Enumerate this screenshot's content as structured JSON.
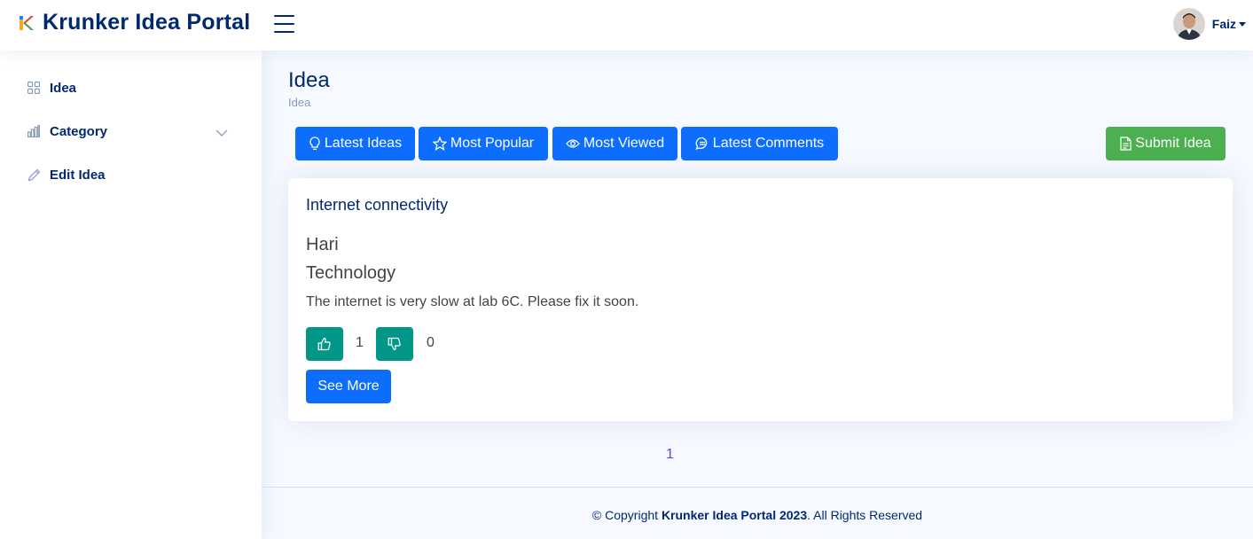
{
  "header": {
    "app_title": "Krunker Idea Portal",
    "user_name": "Faiz"
  },
  "sidebar": {
    "items": [
      {
        "label": "Idea",
        "icon": "grid-icon"
      },
      {
        "label": "Category",
        "icon": "bar-chart-icon"
      },
      {
        "label": "Edit Idea",
        "icon": "pencil-icon"
      }
    ]
  },
  "main": {
    "page_title": "Idea",
    "breadcrumb": "Idea",
    "filters": [
      {
        "label": "Latest Ideas",
        "icon": "lightbulb-icon"
      },
      {
        "label": "Most Popular",
        "icon": "star-icon"
      },
      {
        "label": "Most Viewed",
        "icon": "eye-icon"
      },
      {
        "label": "Latest Comments",
        "icon": "chat-icon"
      }
    ],
    "submit_label": "Submit Idea",
    "idea": {
      "title": "Internet connectivity",
      "author": "Hari",
      "category": "Technology",
      "description": "The internet is very slow at lab 6C. Please fix it soon.",
      "likes": "1",
      "dislikes": "0",
      "see_more_label": "See More"
    },
    "pagination": [
      "1"
    ]
  },
  "footer": {
    "prefix": "© Copyright ",
    "brand": "Krunker Idea Portal 2023",
    "suffix": ". All Rights Reserved"
  },
  "colors": {
    "primary": "#0d6efd",
    "success": "#4caf50",
    "teal": "#009688",
    "navy": "#012970"
  }
}
